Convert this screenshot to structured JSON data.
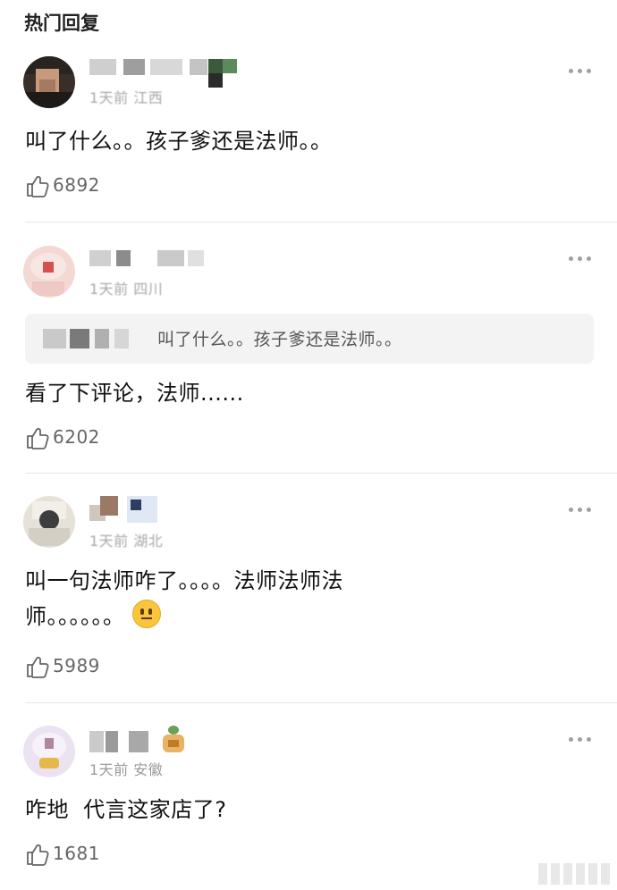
{
  "section": {
    "title": "热门回复"
  },
  "comments": [
    {
      "meta": "1天前 江西",
      "text": "叫了什么。。孩子爹还是法师。。",
      "likes": "6892"
    },
    {
      "meta": "1天前 四川",
      "quote_text": "叫了什么。。孩子爹还是法师。。",
      "text": "看了下评论，法师......",
      "likes": "6202"
    },
    {
      "meta": "1天前 湖北",
      "text_line1": "叫一句法师咋了。。。。法师法师法",
      "text_line2": "师。。。。。。",
      "emoji": "neutral-face",
      "likes": "5989"
    },
    {
      "meta": "1天前 安徽",
      "text": "咋地  代言这家店了?",
      "likes": "1681"
    }
  ],
  "icons": {
    "like": "thumbs-up-icon",
    "more": "more-dots-icon"
  },
  "colors": {
    "meta": "#9a9a9a",
    "like_count": "#666666",
    "quote_bg": "#f3f3f3",
    "divider": "#e6e6e6"
  }
}
